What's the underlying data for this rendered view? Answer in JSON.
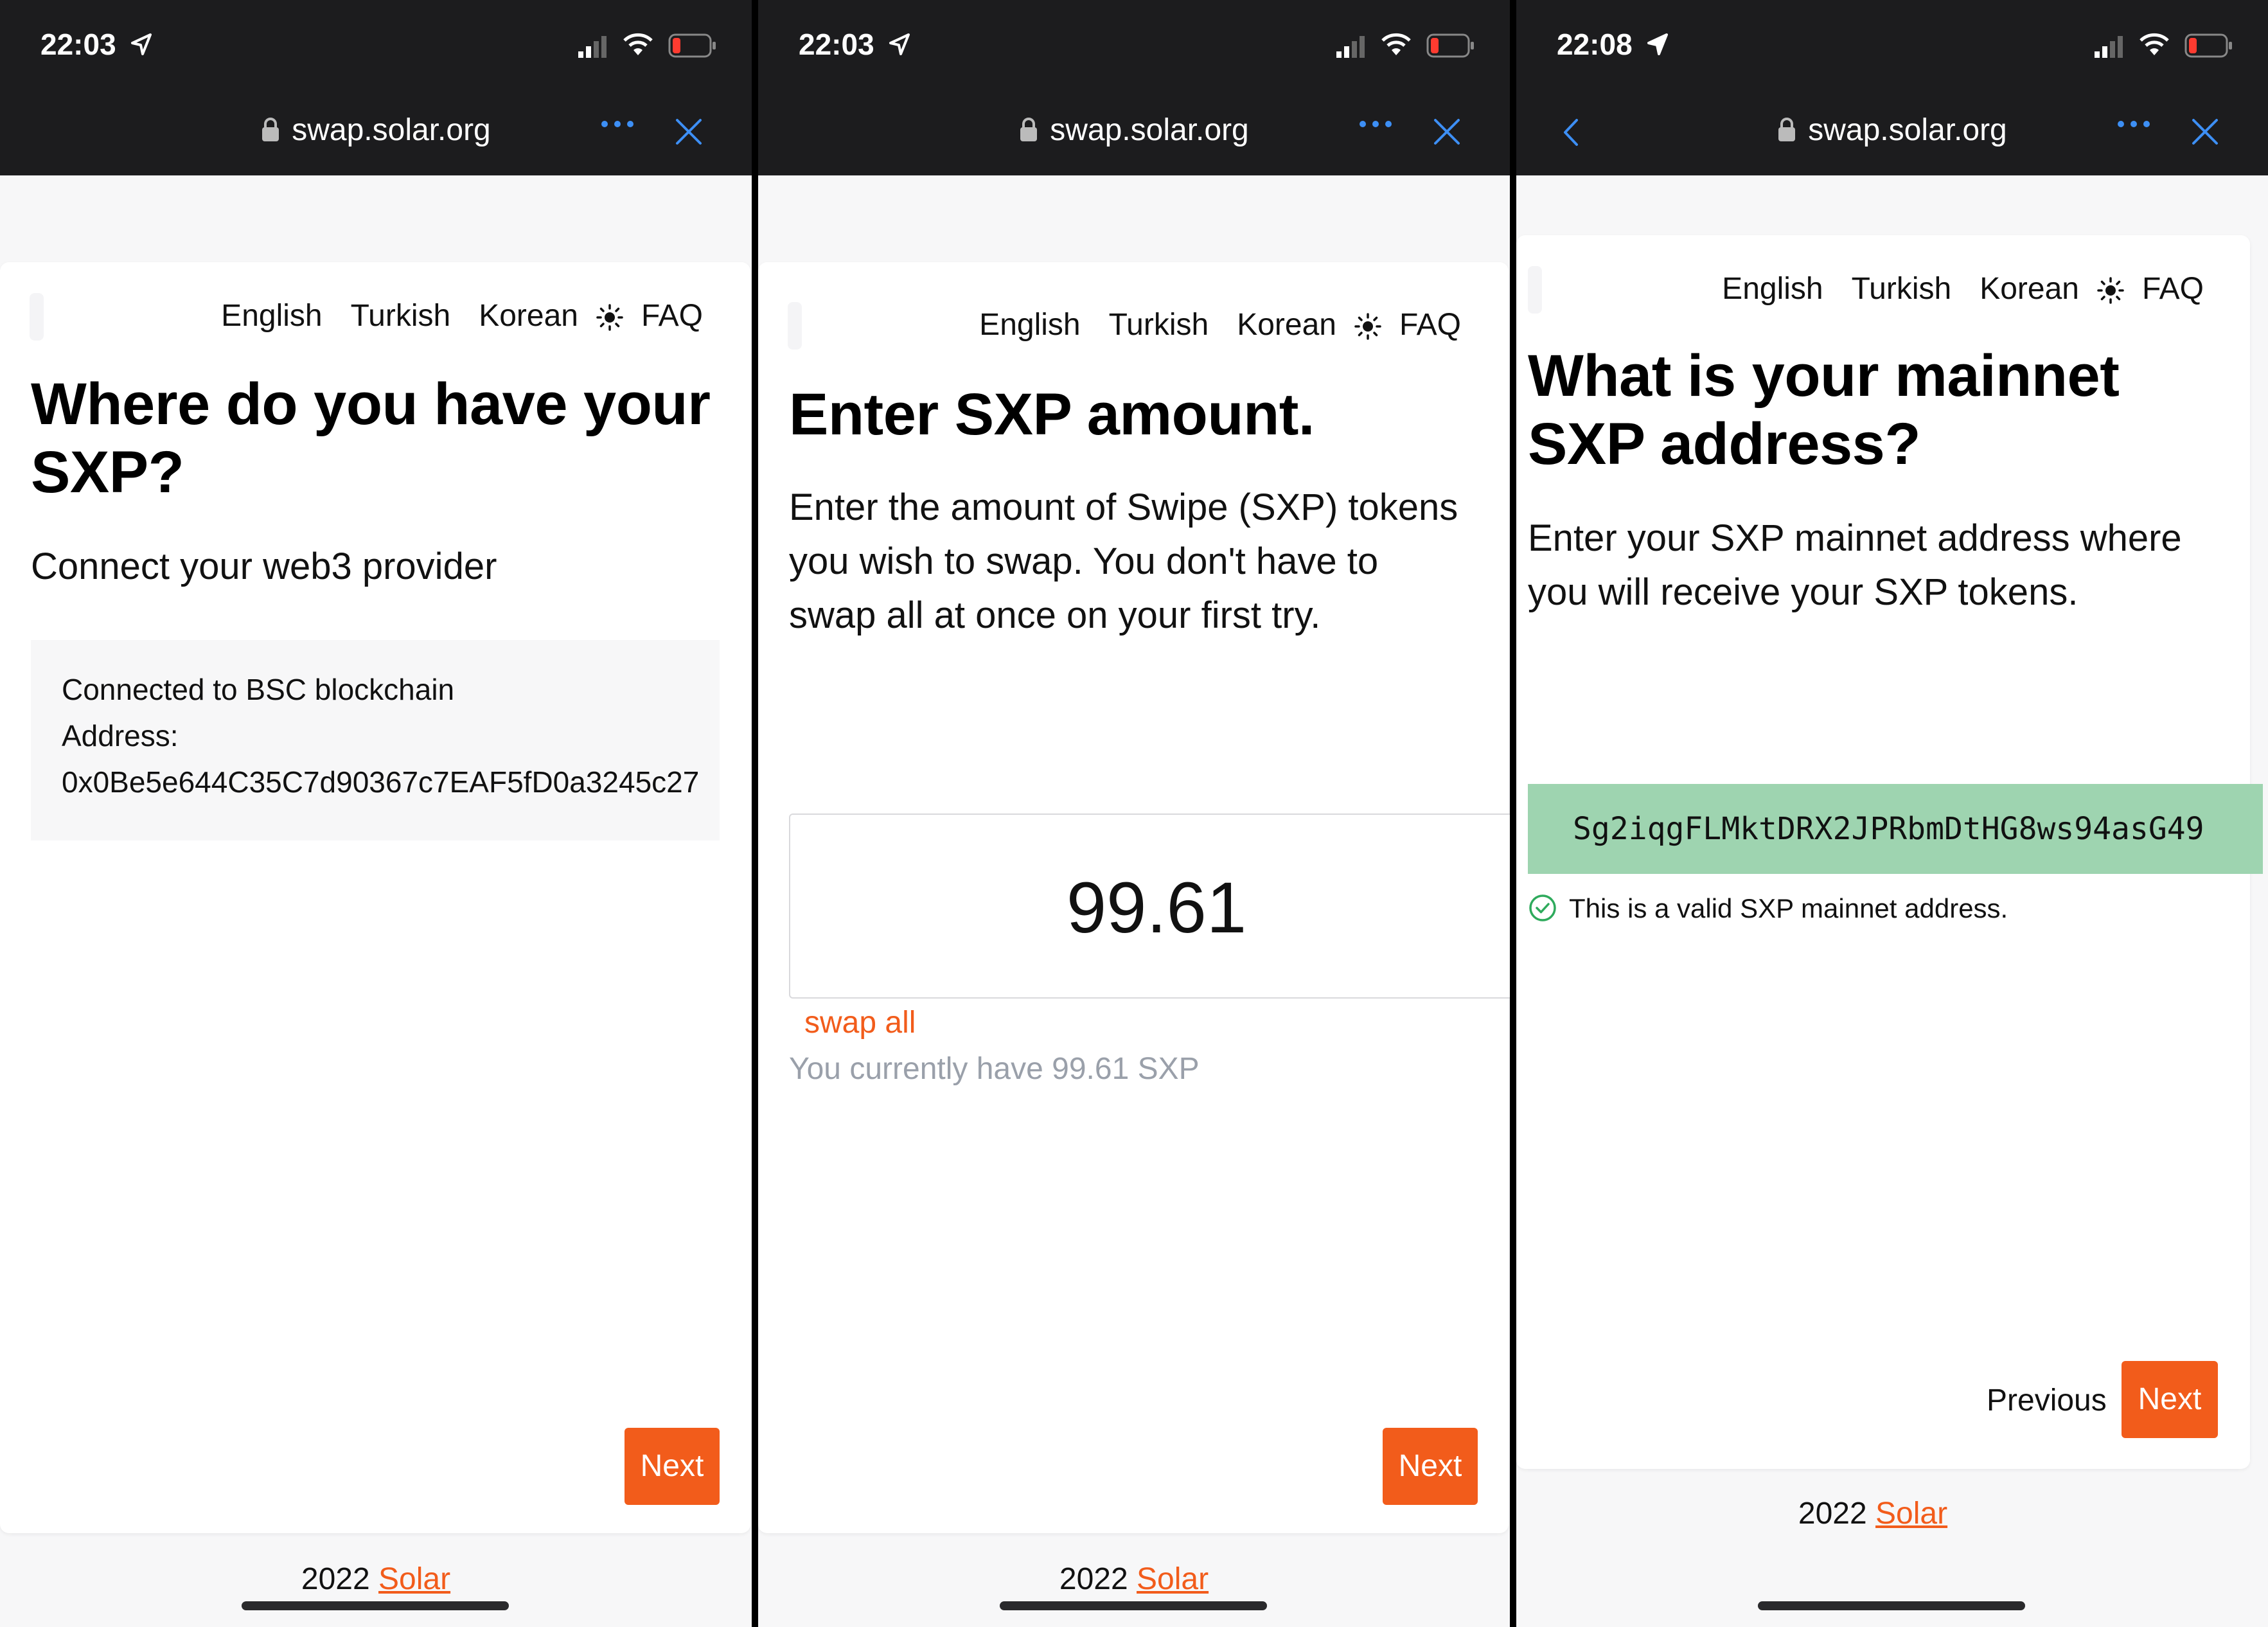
{
  "screens": [
    {
      "status": {
        "time": "22:03"
      },
      "browser": {
        "url": "swap.solar.org"
      },
      "nav": {
        "english": "English",
        "turkish": "Turkish",
        "korean": "Korean",
        "faq": "FAQ"
      },
      "title": "Where do you have your SXP?",
      "subtitle": "Connect your web3 provider",
      "connection": {
        "line1": "Connected to BSC blockchain",
        "line2": "Address:",
        "address": "0x0Be5e644C35C7d90367c7EAF5fD0a3245c27"
      },
      "next_label": "Next",
      "footer": {
        "year": "2022",
        "link": "Solar"
      }
    },
    {
      "status": {
        "time": "22:03"
      },
      "browser": {
        "url": "swap.solar.org"
      },
      "nav": {
        "english": "English",
        "turkish": "Turkish",
        "korean": "Korean",
        "faq": "FAQ"
      },
      "title": "Enter SXP amount.",
      "description": "Enter the amount of Swipe (SXP) tokens you wish to swap. You don't have to swap all at once on your first try.",
      "amount": "99.61",
      "swap_all": "swap all",
      "balance": "You currently have 99.61 SXP",
      "next_label": "Next",
      "footer": {
        "year": "2022",
        "link": "Solar"
      }
    },
    {
      "status": {
        "time": "22:08"
      },
      "browser": {
        "url": "swap.solar.org"
      },
      "nav": {
        "english": "English",
        "turkish": "Turkish",
        "korean": "Korean",
        "faq": "FAQ"
      },
      "title": "What is your mainnet SXP address?",
      "description": "Enter your SXP mainnet address where you will receive your SXP tokens.",
      "address_value": "Sg2iqgFLMktDRX2JPRbmDtHG8ws94asG49",
      "validation": "This is a valid SXP mainnet address.",
      "previous_label": "Previous",
      "next_label": "Next",
      "footer": {
        "year": "2022",
        "link": "Solar"
      }
    }
  ],
  "colors": {
    "accent": "#f25c1b",
    "valid_bg": "#9ed4b0",
    "browser_bar": "#1c1c1e",
    "link_blue": "#3d8ff5"
  },
  "icons": [
    "location-arrow-icon",
    "cellular-signal-icon",
    "wifi-icon",
    "battery-low-icon",
    "lock-icon",
    "more-dots-icon",
    "close-icon",
    "back-chevron-icon",
    "sun-icon",
    "check-circle-icon"
  ]
}
